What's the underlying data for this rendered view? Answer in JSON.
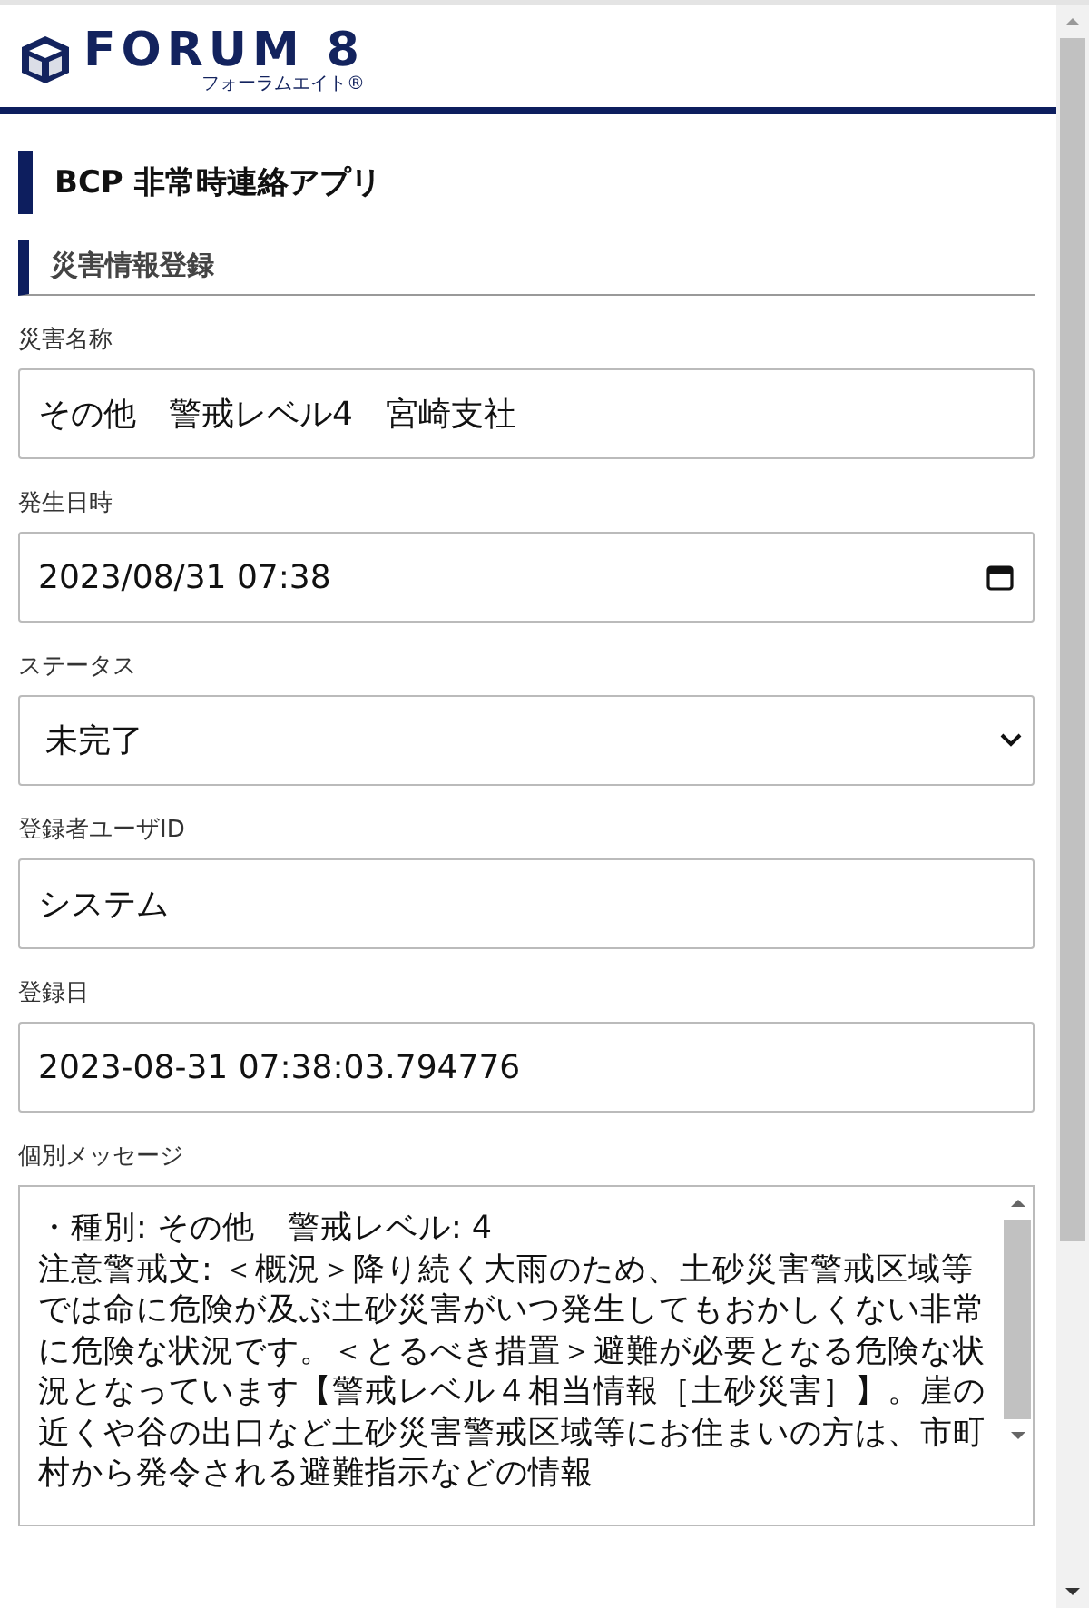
{
  "header": {
    "logo": "FORUM 8",
    "logo_sub": "フォーラムエイト®"
  },
  "app_title": "BCP 非常時連絡アプリ",
  "section_title": "災害情報登録",
  "fields": [
    {
      "kind": "text",
      "label": "災害名称",
      "value": "その他　警戒レベル4　宮崎支社"
    },
    {
      "kind": "date",
      "label": "発生日時",
      "value": "2023/08/31 07:38"
    },
    {
      "kind": "select",
      "label": "ステータス",
      "value": "未完了"
    },
    {
      "kind": "text",
      "label": "登録者ユーザID",
      "value": "システム"
    },
    {
      "kind": "text",
      "label": "登録日",
      "value": "2023-08-31 07:38:03.794776"
    },
    {
      "kind": "textarea",
      "label": "個別メッセージ",
      "value": "・種別: その他　警戒レベル: 4\n注意警戒文: ＜概況＞降り続く大雨のため、土砂災害警戒区域等では命に危険が及ぶ土砂災害がいつ発生してもおかしくない非常に危険な状況です。＜とるべき措置＞避難が必要となる危険な状況となっています【警戒レベル４相当情報［土砂災害］】。崖の近くや谷の出口など土砂災害警戒区域等にお住まいの方は、市町村から発令される避難指示などの情報"
    }
  ]
}
